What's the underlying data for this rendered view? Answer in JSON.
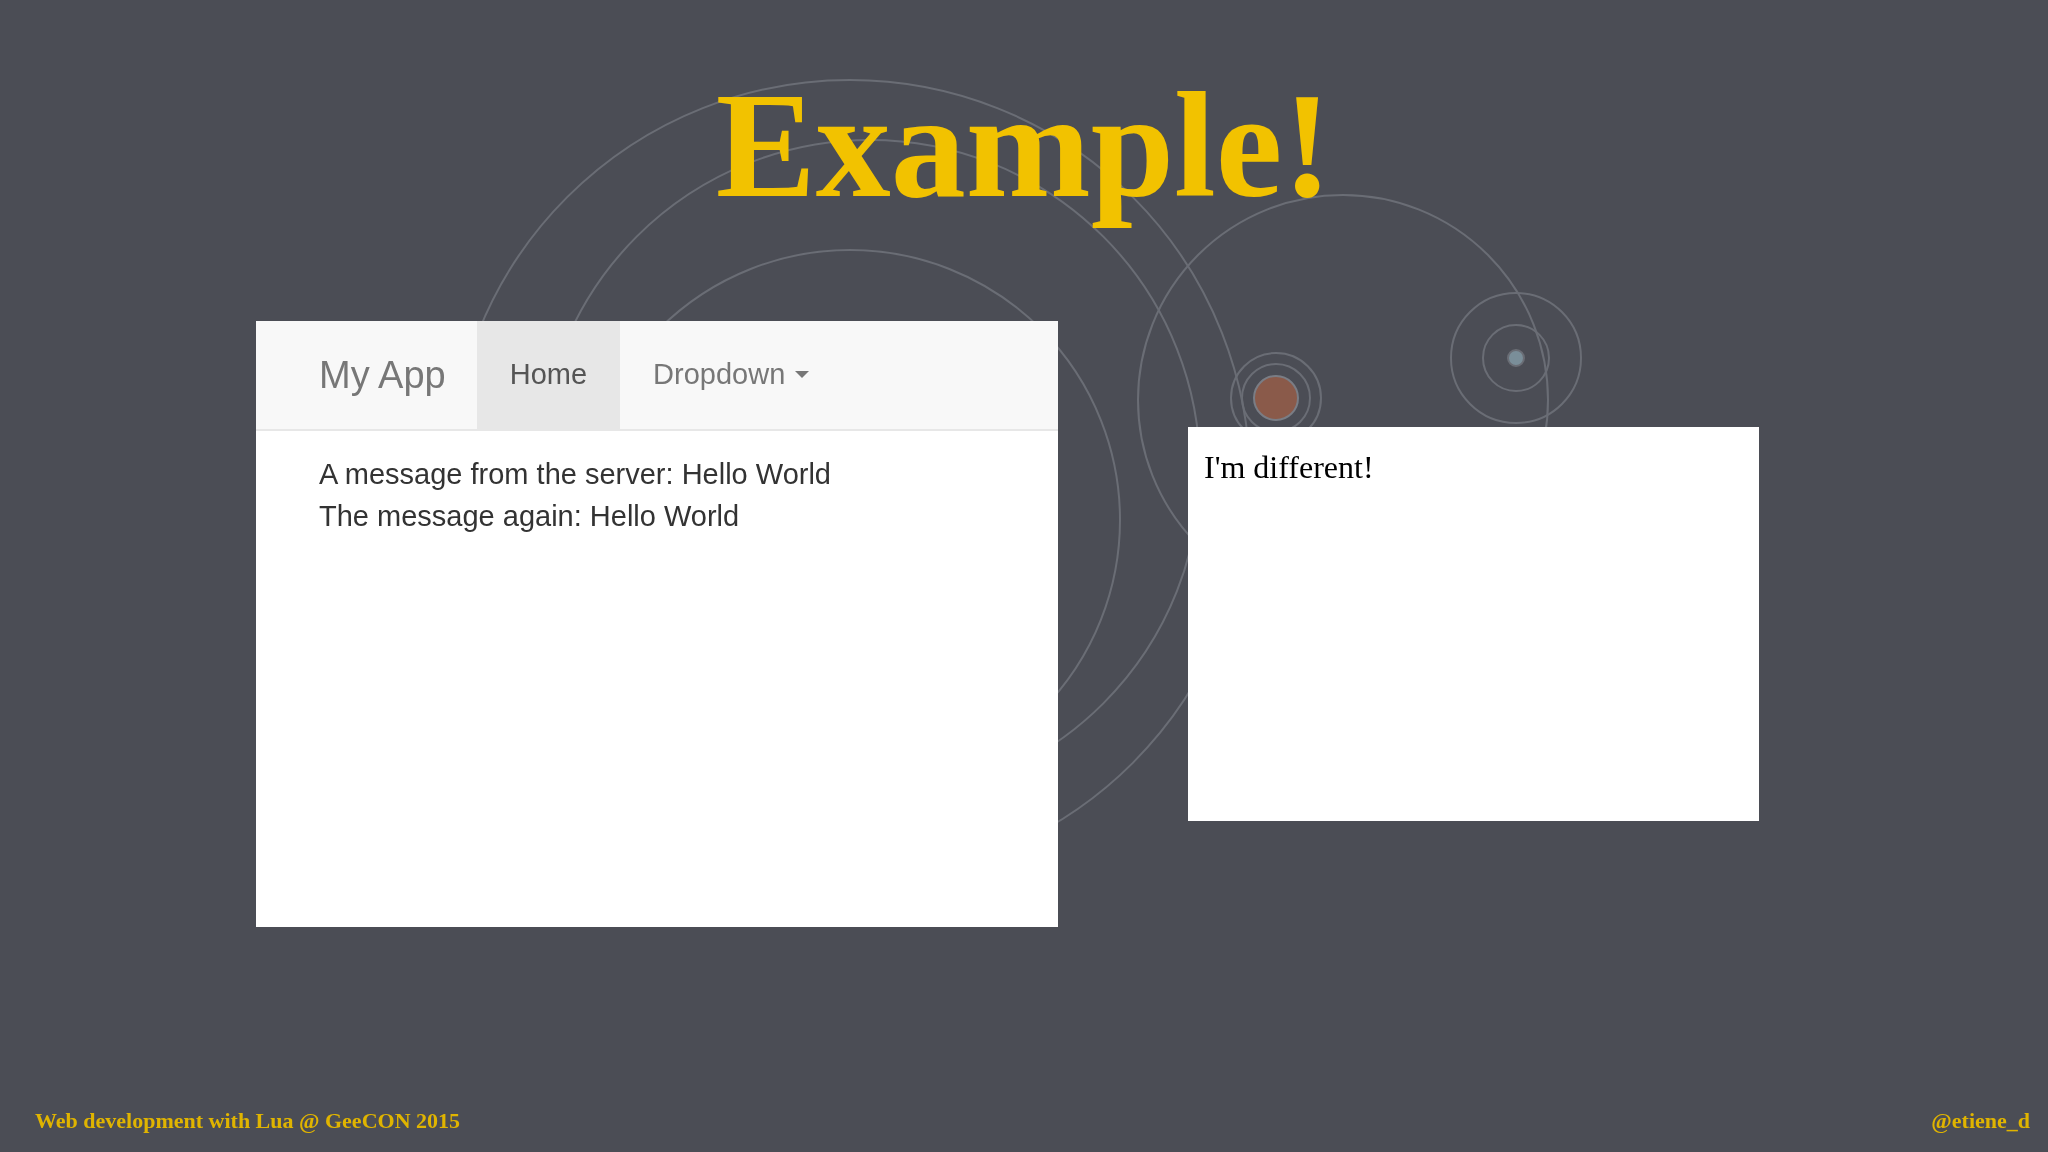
{
  "slide": {
    "title": "Example!"
  },
  "app_window": {
    "brand": "My App",
    "nav_items": [
      {
        "label": "Home",
        "selected": true,
        "kind": "link"
      },
      {
        "label": "Dropdown",
        "selected": false,
        "kind": "dropdown"
      }
    ],
    "messages": [
      "A message from the server: Hello World",
      "The message again: Hello World"
    ]
  },
  "second_window": {
    "text": "I'm different!"
  },
  "footer": {
    "left": "Web development with Lua @ GeeCON 2015",
    "right": "@etiene_d"
  }
}
